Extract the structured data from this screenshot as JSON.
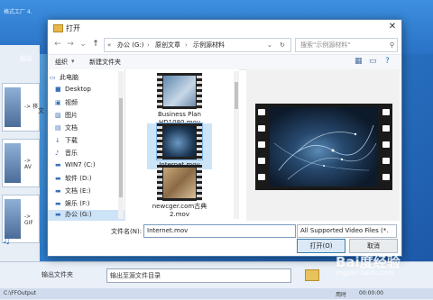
{
  "dialog": {
    "title": "打开",
    "address": [
      "办公 (G:)",
      "原创文章",
      "示例源材料"
    ],
    "search_placeholder": "搜索\"示例源材料\"",
    "toolbar": {
      "organize": "组织",
      "new_folder": "新建文件夹"
    },
    "nav_items": [
      {
        "label": "此电脑",
        "icon": "computer-icon"
      },
      {
        "label": "Desktop",
        "icon": "desktop-icon"
      },
      {
        "label": "视频",
        "icon": "video-icon"
      },
      {
        "label": "图片",
        "icon": "picture-icon"
      },
      {
        "label": "文档",
        "icon": "document-icon"
      },
      {
        "label": "下载",
        "icon": "download-icon"
      },
      {
        "label": "音乐",
        "icon": "music-icon"
      },
      {
        "label": "WIN7 (C:)",
        "icon": "drive-icon"
      },
      {
        "label": "软件 (D:)",
        "icon": "drive-icon"
      },
      {
        "label": "文档 (E:)",
        "icon": "drive-icon"
      },
      {
        "label": "娱乐 (F:)",
        "icon": "drive-icon"
      },
      {
        "label": "办公 (G:)",
        "icon": "drive-icon",
        "selected": true
      }
    ],
    "files": [
      {
        "name": "Business Plan HD1080.mov"
      },
      {
        "name": "Internet.mov",
        "selected": true
      },
      {
        "name": "newcger.com古典2.mov"
      }
    ],
    "filename_label": "文件名(N):",
    "filename_value": "Internet.mov",
    "filetype_value": "All Supported Video Files (*.",
    "open_label": "打开(O)",
    "cancel_label": "取消"
  },
  "app": {
    "title": "格式工厂 4.",
    "left_labels": [
      "输出",
      "文",
      "-> 移",
      "-> AV",
      "-> GIF"
    ],
    "output_folder_label": "输出文件夹",
    "output_folder_value": "输出至源文件目录",
    "footer": [
      "C:\\FFOutput",
      "用时",
      "00:00:00"
    ]
  },
  "watermark": {
    "text": "Bai度经验",
    "sub": "jingyan.baidu.com"
  }
}
